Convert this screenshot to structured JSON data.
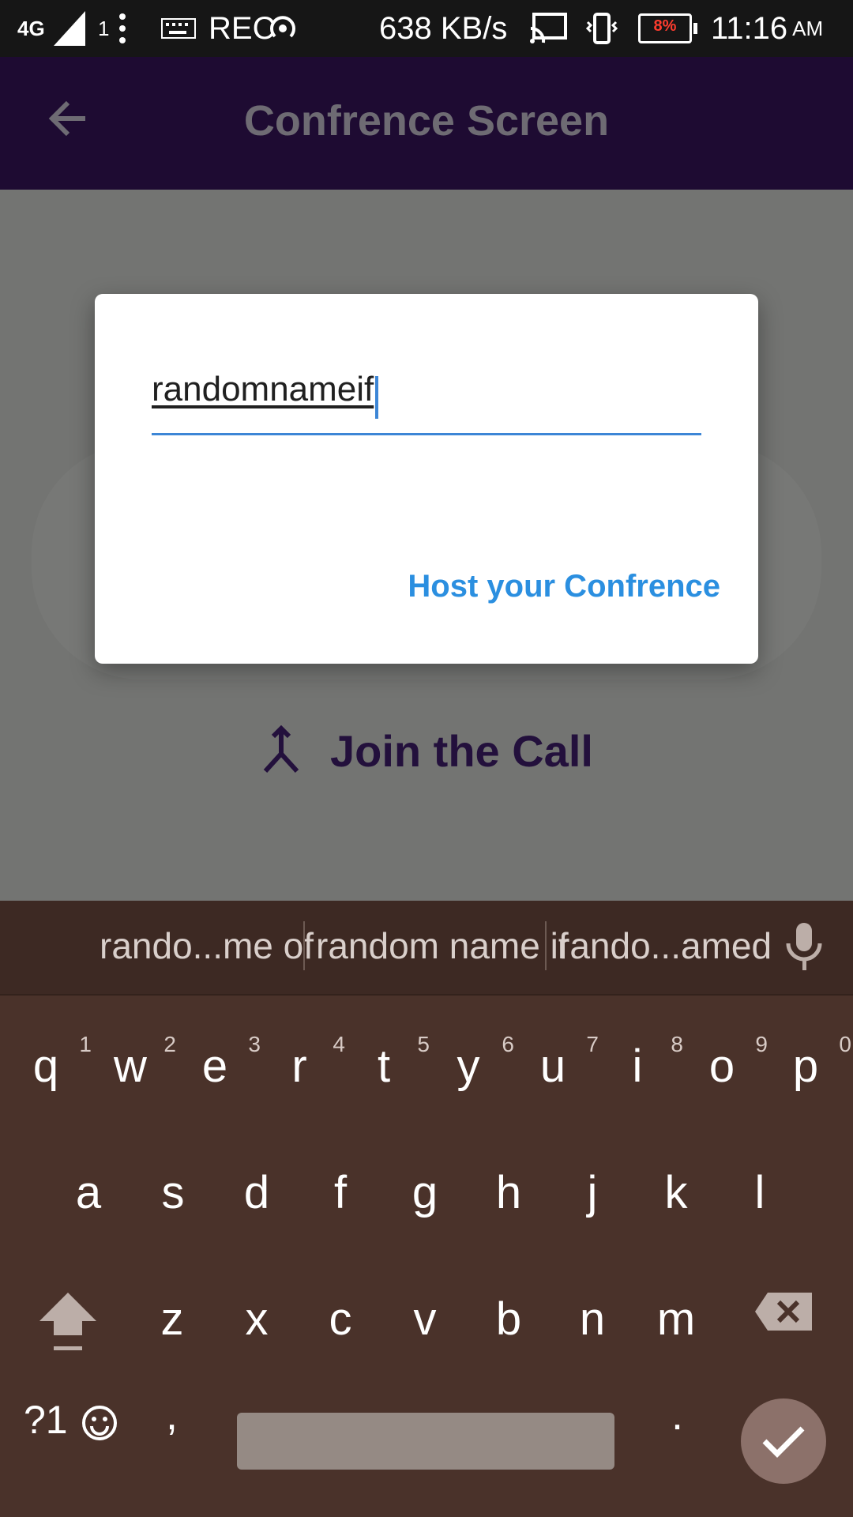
{
  "status_bar": {
    "network": "4G",
    "sim": "1",
    "rec": "REC",
    "speed": "638 KB/s",
    "battery": "8%",
    "time": "11:16",
    "ampm": "AM"
  },
  "appbar": {
    "title": "Confrence Screen"
  },
  "dialog": {
    "input_value": "randomnameif",
    "host_button": "Host your Confrence"
  },
  "join_button": {
    "label": "Join the Call"
  },
  "keyboard": {
    "suggestions": [
      "rando...me of",
      "random name if",
      "rando...amed"
    ],
    "row1": [
      "q",
      "w",
      "e",
      "r",
      "t",
      "y",
      "u",
      "i",
      "o",
      "p"
    ],
    "row1_numbers": [
      "1",
      "2",
      "3",
      "4",
      "5",
      "6",
      "7",
      "8",
      "9",
      "0"
    ],
    "row2": [
      "a",
      "s",
      "d",
      "f",
      "g",
      "h",
      "j",
      "k",
      "l"
    ],
    "row3": [
      "z",
      "x",
      "c",
      "v",
      "b",
      "n",
      "m"
    ],
    "symbols_label": "?1",
    "comma": ",",
    "period": "."
  },
  "colors": {
    "appbar": "#1e0b32",
    "accent": "#2b8fe0",
    "keyboard": "#4a322a"
  }
}
